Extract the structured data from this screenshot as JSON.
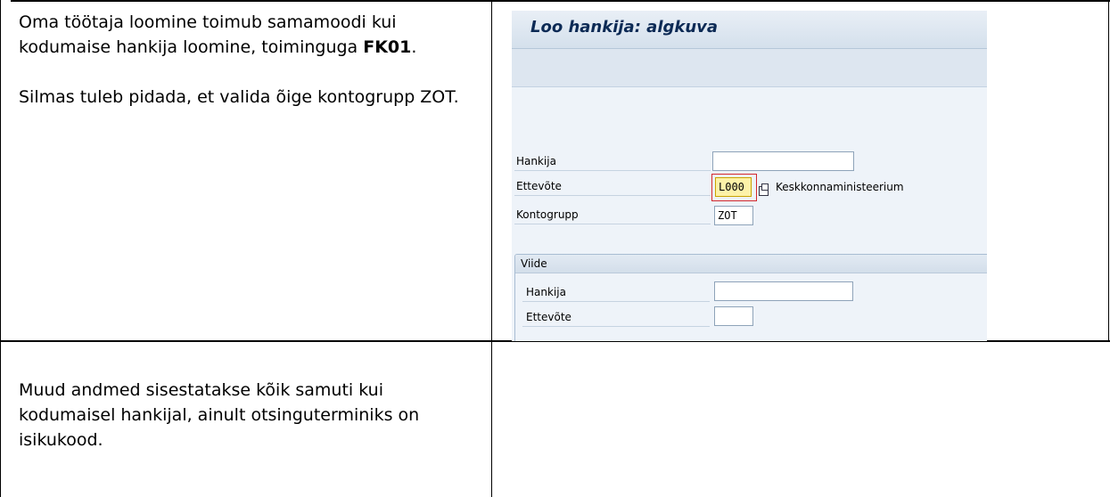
{
  "row1": {
    "left": {
      "para1_before": "Oma töötaja loomine toimub samamoodi kui kodumaise hankija loomine, toiminguga ",
      "para1_bold": "FK01",
      "para1_after": ".",
      "para2": "Silmas tuleb pidada, et valida õige kontogrupp ZOT."
    }
  },
  "row2": {
    "left": {
      "text": "Muud andmed sisestatakse kõik samuti kui kodumaisel hankijal, ainult otsinguterminiks on isikukood."
    }
  },
  "sap": {
    "title": "Loo hankija:  algkuva",
    "fields": {
      "hankija_label": "Hankija",
      "hankija_value": "",
      "ettevote_label": "Ettevõte",
      "ettevote_value": "L000",
      "ettevote_desc": "Keskkonnaministeerium",
      "kontogrupp_label": "Kontogrupp",
      "kontogrupp_value": "ZOT"
    },
    "group": {
      "title": "Viide",
      "hankija_label": "Hankija",
      "hankija_value": "",
      "ettevote_label": "Ettevõte",
      "ettevote_value": ""
    }
  },
  "colors": {
    "sap_background": "#e5edf6",
    "sap_title_text": "#0c2a55",
    "focus_field": "#fdf2a8"
  }
}
